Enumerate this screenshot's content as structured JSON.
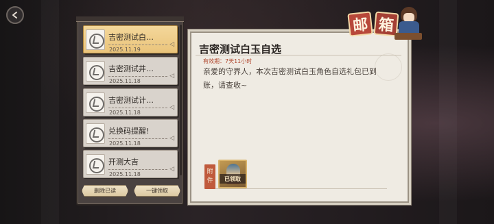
{
  "header": {
    "title_chars": [
      "邮",
      "箱"
    ]
  },
  "mail_list": {
    "items": [
      {
        "title": "吉密测试白…",
        "date": "2025.11.19",
        "selected": true
      },
      {
        "title": "吉密测试井…",
        "date": "2025.11.18",
        "selected": false
      },
      {
        "title": "吉密测试计…",
        "date": "2025.11.18",
        "selected": false
      },
      {
        "title": "兑换码提醒!",
        "date": "2025.11.18",
        "selected": false
      },
      {
        "title": "开测大吉",
        "date": "2025.11.18",
        "selected": false
      }
    ],
    "delete_read_label": "删除已读",
    "claim_all_label": "一键领取"
  },
  "mail_detail": {
    "title": "吉密测试白玉自选",
    "expiry": "有效期：7天11小时",
    "body": "亲爱的守界人，本次吉密测试白玉角色自选礼包已到账，请查收~",
    "attachment_label_chars": [
      "附",
      "件"
    ],
    "attachment": {
      "status": "已领取"
    }
  },
  "colors": {
    "selected_item": "#eac47b",
    "expiry_text": "#b0462d",
    "attachment_tag": "#c05a3c"
  }
}
